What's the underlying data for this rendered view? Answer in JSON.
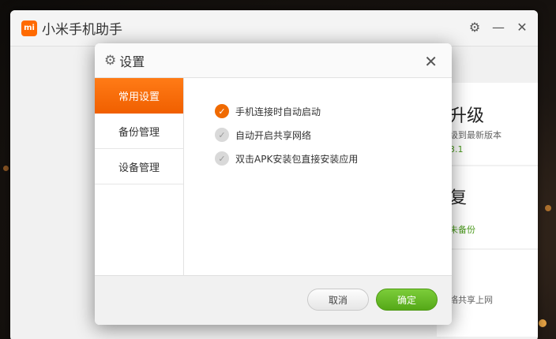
{
  "app": {
    "title": "小米手机助手",
    "logo_text": "mi",
    "controls": {
      "settings": "⚙",
      "minimize": "—",
      "close": "✕"
    },
    "cards": [
      {
        "big": "升级",
        "small": "级到最新版本",
        "extra": "3.1"
      },
      {
        "big": "复",
        "green": "未备份"
      },
      {
        "small": "络共享上网"
      }
    ]
  },
  "dialog": {
    "title": "设置",
    "gear": "⚙",
    "close": "✕",
    "sidebar": [
      {
        "label": "常用设置",
        "active": true
      },
      {
        "label": "备份管理",
        "active": false
      },
      {
        "label": "设备管理",
        "active": false
      }
    ],
    "options": [
      {
        "label": "手机连接时自动启动",
        "checked": true
      },
      {
        "label": "自动开启共享网络",
        "checked": false
      },
      {
        "label": "双击APK安装包直接安装应用",
        "checked": false
      }
    ],
    "check_glyph": "✓",
    "buttons": {
      "cancel": "取消",
      "ok": "确定"
    }
  },
  "colors": {
    "accent_orange": "#f06a00",
    "ok_green": "#5cb21e",
    "brand": "#ff6a00"
  }
}
